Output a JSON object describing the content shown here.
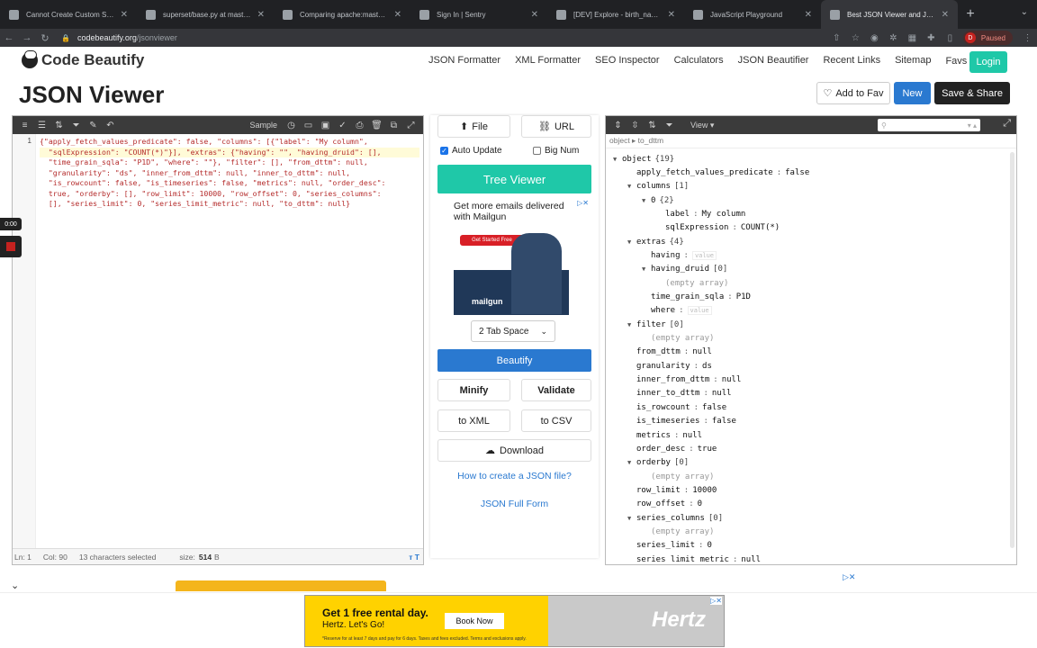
{
  "browser": {
    "tabs": [
      {
        "title": "Cannot Create Custom SQL Co…",
        "active": false
      },
      {
        "title": "superset/base.py at master · a…",
        "active": false
      },
      {
        "title": "Comparing apache:master...c…",
        "active": false
      },
      {
        "title": "Sign In | Sentry",
        "active": false
      },
      {
        "title": "[DEV] Explore - birth_names",
        "active": false
      },
      {
        "title": "JavaScript Playground",
        "active": false
      },
      {
        "title": "Best JSON Viewer and JSON B…",
        "active": true
      }
    ],
    "url_domain": "codebeautify.org",
    "url_path": "/jsonviewer",
    "profile_initial": "D",
    "profile_status": "Paused"
  },
  "site": {
    "logo": "Code Beautify",
    "nav": [
      "JSON Formatter",
      "XML Formatter",
      "SEO Inspector",
      "Calculators",
      "JSON Beautifier",
      "Recent Links",
      "Sitemap",
      "Favs"
    ],
    "login": "Login",
    "page_title": "JSON Viewer",
    "add_to_fav": "Add to Fav",
    "new": "New",
    "save_share": "Save & Share"
  },
  "editor": {
    "toolbar_label": "Sample",
    "line_number": "1",
    "code_lines": [
      "{\"apply_fetch_values_predicate\": false, \"columns\": [{\"label\": \"My column\",",
      "  \"sqlExpression\": \"COUNT(*)\"}], \"extras\": {\"having\": \"\", \"having_druid\": [],",
      "  \"time_grain_sqla\": \"P1D\", \"where\": \"\"}, \"filter\": [], \"from_dttm\": null,",
      "  \"granularity\": \"ds\", \"inner_from_dttm\": null, \"inner_to_dttm\": null,",
      "  \"is_rowcount\": false, \"is_timeseries\": false, \"metrics\": null, \"order_desc\":",
      "  true, \"orderby\": [], \"row_limit\": 10000, \"row_offset\": 0, \"series_columns\":",
      "  [], \"series_limit\": 0, \"series_limit_metric\": null, \"to_dttm\": null}"
    ],
    "status_ln": "Ln: 1",
    "status_col": "Col: 90",
    "status_selected": "13 characters selected",
    "status_size_label": "size:",
    "status_size_value": "514",
    "status_size_unit": "B"
  },
  "recorder": {
    "time": "0:00"
  },
  "middle": {
    "file": "File",
    "url": "URL",
    "auto_update": "Auto Update",
    "auto_update_checked": true,
    "big_num": "Big Num",
    "big_num_checked": false,
    "tree_viewer": "Tree Viewer",
    "ad_headline": "Get more emails delivered with Mailgun",
    "ad_cta": "Get Started Free",
    "ad_brand": "mailgun",
    "tab_space": "2 Tab Space",
    "beautify": "Beautify",
    "minify": "Minify",
    "validate": "Validate",
    "to_xml": "to XML",
    "to_csv": "to CSV",
    "download": "Download",
    "how_to": "How to create a JSON file?",
    "full_form": "JSON Full Form"
  },
  "viewer": {
    "view_label": "View",
    "breadcrumb": "object ▸ to_dttm",
    "tree": [
      {
        "indent": 0,
        "toggle": "▼",
        "key": "object",
        "count": "{19}"
      },
      {
        "indent": 1,
        "key": "apply_fetch_values_predicate",
        "value": "false"
      },
      {
        "indent": 1,
        "toggle": "▼",
        "key": "columns",
        "count": "[1]"
      },
      {
        "indent": 2,
        "toggle": "▼",
        "key": "0",
        "count": "{2}"
      },
      {
        "indent": 3,
        "key": "label",
        "value": "My column"
      },
      {
        "indent": 3,
        "key": "sqlExpression",
        "value": "COUNT(*)"
      },
      {
        "indent": 1,
        "toggle": "▼",
        "key": "extras",
        "count": "{4}"
      },
      {
        "indent": 2,
        "key": "having",
        "placeholder": "value"
      },
      {
        "indent": 2,
        "toggle": "▼",
        "key": "having_druid",
        "count": "[0]"
      },
      {
        "indent": 3,
        "empty": "(empty array)"
      },
      {
        "indent": 2,
        "key": "time_grain_sqla",
        "value": "P1D"
      },
      {
        "indent": 2,
        "key": "where",
        "placeholder": "value"
      },
      {
        "indent": 1,
        "toggle": "▼",
        "key": "filter",
        "count": "[0]"
      },
      {
        "indent": 2,
        "empty": "(empty array)"
      },
      {
        "indent": 1,
        "key": "from_dttm",
        "value": "null"
      },
      {
        "indent": 1,
        "key": "granularity",
        "value": "ds"
      },
      {
        "indent": 1,
        "key": "inner_from_dttm",
        "value": "null"
      },
      {
        "indent": 1,
        "key": "inner_to_dttm",
        "value": "null"
      },
      {
        "indent": 1,
        "key": "is_rowcount",
        "value": "false"
      },
      {
        "indent": 1,
        "key": "is_timeseries",
        "value": "false"
      },
      {
        "indent": 1,
        "key": "metrics",
        "value": "null"
      },
      {
        "indent": 1,
        "key": "order_desc",
        "value": "true"
      },
      {
        "indent": 1,
        "toggle": "▼",
        "key": "orderby",
        "count": "[0]"
      },
      {
        "indent": 2,
        "empty": "(empty array)"
      },
      {
        "indent": 1,
        "key": "row_limit",
        "value": "10000"
      },
      {
        "indent": 1,
        "key": "row_offset",
        "value": "0"
      },
      {
        "indent": 1,
        "toggle": "▼",
        "key": "series_columns",
        "count": "[0]"
      },
      {
        "indent": 2,
        "empty": "(empty array)"
      },
      {
        "indent": 1,
        "key": "series_limit",
        "value": "0"
      },
      {
        "indent": 1,
        "key": "series_limit_metric",
        "value": "null"
      }
    ]
  },
  "bottom_ad": {
    "headline": "Get 1 free rental day.",
    "sub": "Hertz. Let's Go!",
    "button": "Book Now",
    "fine_print": "*Reserve for at least 7 days and pay for 6 days. Taxes and fees excluded. Terms and exclusions apply.",
    "brand": "Hertz"
  },
  "colors": {
    "accent_green": "#1fc8a8",
    "accent_blue": "#2a79d0",
    "dark": "#222222"
  }
}
